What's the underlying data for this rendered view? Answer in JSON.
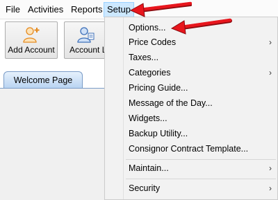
{
  "menubar": {
    "items": [
      {
        "label": "File"
      },
      {
        "label": "Activities"
      },
      {
        "label": "Reports"
      },
      {
        "label": "Setup"
      }
    ]
  },
  "toolbar": {
    "buttons": [
      {
        "label": "Add Account",
        "icon": "add-user-icon"
      },
      {
        "label": "Account Lookup",
        "icon": "account-lookup-icon"
      }
    ]
  },
  "tabs": [
    {
      "label": "Welcome Page"
    }
  ],
  "setup_menu": {
    "items": [
      {
        "label": "Options...",
        "submenu": false
      },
      {
        "label": "Price Codes",
        "submenu": true
      },
      {
        "label": "Taxes...",
        "submenu": false
      },
      {
        "label": "Categories",
        "submenu": true
      },
      {
        "label": "Pricing Guide...",
        "submenu": false
      },
      {
        "label": "Message of the Day...",
        "submenu": false
      },
      {
        "label": "Widgets...",
        "submenu": false
      },
      {
        "label": "Backup Utility...",
        "submenu": false
      },
      {
        "label": "Consignor Contract Template...",
        "submenu": false
      },
      {
        "label": "Maintain...",
        "submenu": true
      },
      {
        "label": "Security",
        "submenu": true
      }
    ],
    "submenu_arrow": "›"
  },
  "colors": {
    "menu_highlight": "#cce8ff",
    "annotation_arrow": "#e8161d",
    "tab_fill": "#b9d4f2"
  }
}
